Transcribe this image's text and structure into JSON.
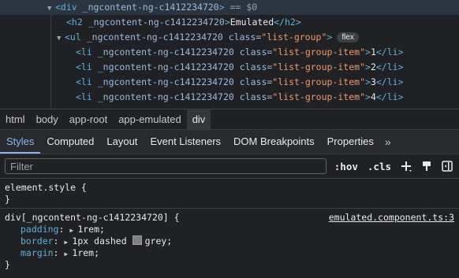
{
  "elements": {
    "rows": [
      {
        "open": "<div",
        "attr": "_ngcontent-ng-c1412234720",
        "close": ">",
        "suffix": " == $0"
      },
      {
        "h2_open": "<h2",
        "attr": "_ngcontent-ng-c1412234720",
        "text": "Emulated",
        "h2_close": "</h2>"
      },
      {
        "ul_open": "<ul",
        "attr": "_ngcontent-ng-c1412234720",
        "class_attr": "class=",
        "class_val": "\"list-group\"",
        "close": ">",
        "badge": "flex"
      },
      {
        "li": "<li",
        "attr": "_ngcontent-ng-c1412234720",
        "class_attr": "class=",
        "class_val": "\"list-group-item\"",
        "text": "1",
        "end": "</li>"
      },
      {
        "li": "<li",
        "attr": "_ngcontent-ng-c1412234720",
        "class_attr": "class=",
        "class_val": "\"list-group-item\"",
        "text": "2",
        "end": "</li>"
      },
      {
        "li": "<li",
        "attr": "_ngcontent-ng-c1412234720",
        "class_attr": "class=",
        "class_val": "\"list-group-item\"",
        "text": "3",
        "end": "</li>"
      },
      {
        "li": "<li",
        "attr": "_ngcontent-ng-c1412234720",
        "class_attr": "class=",
        "class_val": "\"list-group-item\"",
        "text": "4",
        "end": "</li>"
      }
    ]
  },
  "breadcrumbs": [
    "html",
    "body",
    "app-root",
    "app-emulated",
    "div"
  ],
  "tabs": [
    "Styles",
    "Computed",
    "Layout",
    "Event Listeners",
    "DOM Breakpoints",
    "Properties"
  ],
  "tabs_more": "»",
  "toolbar": {
    "filter_placeholder": "Filter",
    "hov": ":hov",
    "cls": ".cls"
  },
  "element_style": {
    "selector": "element.style {",
    "close": "}"
  },
  "rule": {
    "selector": "div[_ngcontent-ng-c1412234720] {",
    "source": "emulated.component.ts:3",
    "props": [
      {
        "name": "padding",
        "value": "1rem;"
      },
      {
        "name": "border",
        "value": "1px dashed",
        "swatch_value": "grey;"
      },
      {
        "name": "margin",
        "value": "1rem;"
      }
    ],
    "close": "}"
  },
  "colors": {
    "accent": "#8ab4f8",
    "grey_swatch": "#808080"
  }
}
